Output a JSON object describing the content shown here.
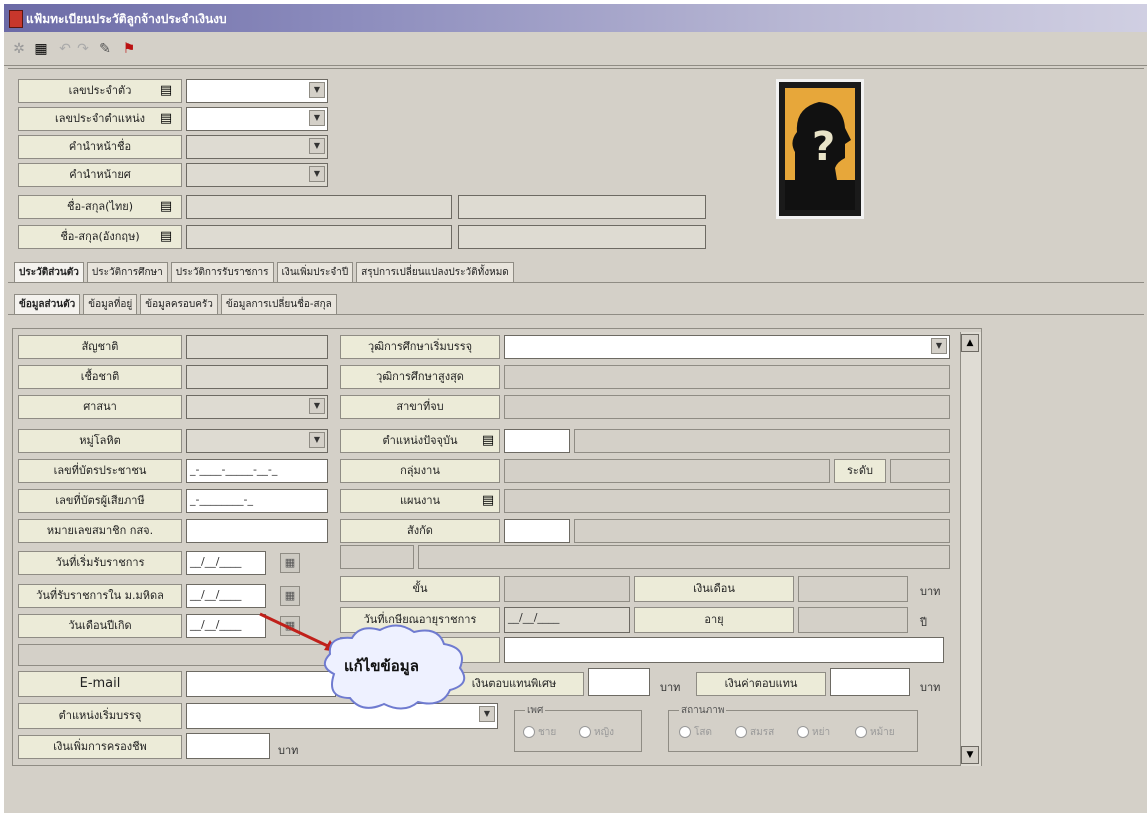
{
  "window": {
    "title": "แฟ้มทะเบียนประวัติลูกจ้างประจำเงินงบ"
  },
  "toolbar": {
    "icons": [
      "new-icon",
      "save-icon",
      "undo-icon",
      "redo-icon",
      "edit-icon",
      "exit-icon"
    ]
  },
  "header_fields": [
    {
      "label": "เลขประจำตัว"
    },
    {
      "label": "เลขประจำตำแหน่ง"
    },
    {
      "label": "คำนำหน้าชื่อ"
    },
    {
      "label": "คำนำหน้ายศ"
    },
    {
      "label": "ชื่อ-สกุล(ไทย)"
    },
    {
      "label": "ชื่อ-สกุล(อังกฤษ)"
    }
  ],
  "main_tabs": [
    "ประวัติส่วนตัว",
    "ประวัติการศึกษา",
    "ประวัติการรับราชการ",
    "เงินเพิ่มประจำปี",
    "สรุปการเปลี่ยนแปลงประวัติทั้งหมด"
  ],
  "sub_tabs": [
    "ข้อมูลส่วนตัว",
    "ข้อมูลที่อยู่",
    "ข้อมูลครอบครัว",
    "ข้อมูลการเปลี่ยนชื่อ-สกุล"
  ],
  "left_fields": {
    "nationality": "สัญชาติ",
    "race": "เชื้อชาติ",
    "religion": "ศาสนา",
    "blood": "หมู่โลหิต",
    "idcard": "เลขที่บัตรประชาชน",
    "idcard_mask": "_-____-_____-__-_",
    "taxid": "เลขที่บัตรผู้เสียภาษี",
    "taxid_mask": "_-________-_",
    "member": "หมายเลขสมาชิก กสจ.",
    "startdate": "วันที่เริ่มรับราชการ",
    "unidate": "วันที่รับราชการใน ม.มหิดล",
    "birthdate": "วันเดือนปีเกิด",
    "date_mask": "__/__/____"
  },
  "right_fields": {
    "edu_start": "วุฒิการศึกษาเริ่มบรรจุ",
    "edu_high": "วุฒิการศึกษาสูงสุด",
    "major": "สาขาที่จบ",
    "position": "ตำแหน่งปัจจุบัน",
    "workgroup": "กลุ่มงาน",
    "level": "ระดับ",
    "dept": "แผนงาน",
    "unit": "สังกัด",
    "rank": "ขั้น",
    "salary": "เงินเดือน",
    "baht": "บาท",
    "retire": "วันที่เกษียณอายุราชการ",
    "age": "อายุ",
    "year": "ปี"
  },
  "bottom": {
    "email": "E-mail",
    "special_pay": "เงินตอบแทนพิเศษ",
    "comp_pay": "เงินค่าตอบแทน",
    "start_position": "ตำแหน่งเริ่มบรรจุ",
    "living_allowance": "เงินเพิ่มการครองชีพ",
    "gender_group": "เพศ",
    "genders": [
      "ชาย",
      "หญิง"
    ],
    "status_group": "สถานภาพ",
    "statuses": [
      "โสด",
      "สมรส",
      "หย่า",
      "หม้าย"
    ]
  },
  "callout": {
    "text": "แก้ไขข้อมูล"
  },
  "colors": {
    "label_bg": "#ecebd8",
    "window_bg": "#d4d0c8",
    "title_start": "#6b6aa6",
    "arrow": "#c0201a"
  }
}
